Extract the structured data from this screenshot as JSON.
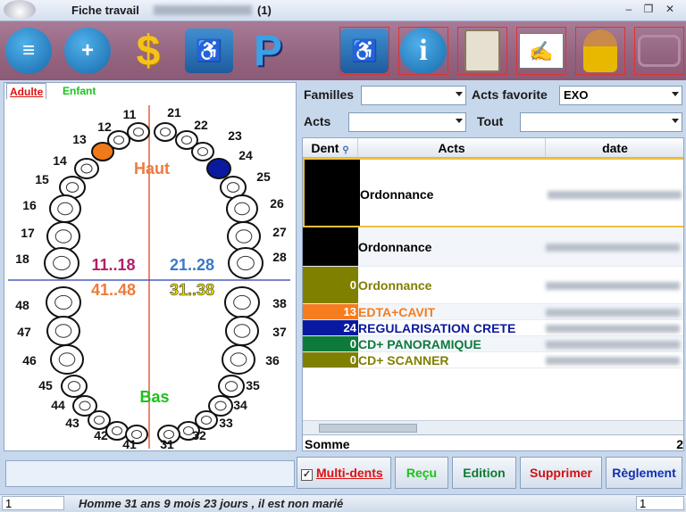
{
  "window": {
    "title": "Fiche travail",
    "count": "(1)",
    "min": "–",
    "restore": "❐",
    "close": "✕"
  },
  "toolbar": {
    "buttons": [
      {
        "name": "patient-card-icon",
        "glyph": "≡"
      },
      {
        "name": "add-patient-icon",
        "glyph": "+"
      },
      {
        "name": "dollar-icon",
        "glyph": "$"
      },
      {
        "name": "waiting-room-icon",
        "glyph": "♿"
      },
      {
        "name": "parking-icon",
        "glyph": "P"
      },
      {
        "name": "waiting-room-icon-2",
        "glyph": "♿"
      },
      {
        "name": "info-icon",
        "glyph": "i"
      },
      {
        "name": "clipboard-icon",
        "glyph": "📋"
      },
      {
        "name": "prescription-icon",
        "glyph": "✍"
      },
      {
        "name": "doctor-icon",
        "glyph": "👤"
      },
      {
        "name": "dental-chair-icon",
        "glyph": "🪑"
      }
    ]
  },
  "tabs": {
    "adulte": "Adulte",
    "enfant": "Enfant"
  },
  "chart": {
    "haut": "Haut",
    "bas": "Bas",
    "q1": "11..18",
    "q2": "21..28",
    "q4": "41..48",
    "q3": "31..38",
    "teeth_numbers": [
      "11",
      "12",
      "13",
      "14",
      "15",
      "16",
      "17",
      "18",
      "21",
      "22",
      "23",
      "24",
      "25",
      "26",
      "27",
      "28",
      "31",
      "32",
      "33",
      "34",
      "35",
      "36",
      "37",
      "38",
      "41",
      "42",
      "43",
      "44",
      "45",
      "46",
      "47",
      "48"
    ],
    "marked": {
      "13": "#f07a1a",
      "24": "#0a1aa0"
    }
  },
  "filters": {
    "familles_label": "Familles",
    "familles_value": "",
    "actes_fav_label": "Acts favorite",
    "actes_fav_value": "EXO",
    "acts_label": "Acts",
    "acts_value": "",
    "tout_label": "Tout",
    "tout_value": ""
  },
  "grid": {
    "headers": {
      "dent": "Dent",
      "acts": "Acts",
      "date": "date"
    },
    "rows": [
      {
        "dent": "",
        "act": "Ordonnance",
        "dent_bg": "#000000",
        "color": "#000000"
      },
      {
        "dent": "",
        "act": "Ordonnance",
        "dent_bg": "#000000",
        "color": "#000000"
      },
      {
        "dent": "0",
        "act": "Ordonnance",
        "dent_bg": "#808000",
        "color": "#808000"
      },
      {
        "dent": "13",
        "act": "EDTA+CAVIT",
        "dent_bg": "#f57c1f",
        "color": "#f57c1f"
      },
      {
        "dent": "24",
        "act": "REGULARISATION CRETE",
        "dent_bg": "#0a1aa0",
        "color": "#0a1aa0"
      },
      {
        "dent": "0",
        "act": "CD+ PANORAMIQUE",
        "dent_bg": "#0e7a3a",
        "color": "#0e7a3a"
      },
      {
        "dent": "0",
        "act": "CD+ SCANNER",
        "dent_bg": "#808000",
        "color": "#808000"
      }
    ],
    "somme_label": "Somme",
    "somme_value": "2"
  },
  "buttons": {
    "multi_dents": "Multi-dents",
    "recu": "Reçu",
    "edition": "Edition",
    "supprimer": "Supprimer",
    "reglement": "Règlement"
  },
  "status": {
    "page": "1",
    "text": "Homme 31 ans 9 mois 23 jours , il est non marié",
    "right": "1"
  }
}
